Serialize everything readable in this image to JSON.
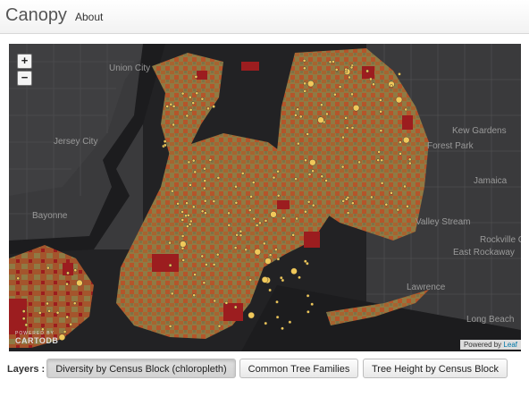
{
  "navbar": {
    "brand": "Canopy",
    "about": "About"
  },
  "map": {
    "place_labels": [
      "Union City",
      "Jersey City",
      "Bayonne",
      "Kew Gardens",
      "Forest Park",
      "Jamaica",
      "Valley Stream",
      "Rockville Cen",
      "East Rockaway",
      "Lawrence",
      "Long Beach"
    ],
    "powered_by_label": "POWERED BY",
    "carto_logo": "CARTODB",
    "attribution_prefix": "Powered by",
    "attribution_link": "Leaf",
    "zoom_in": "+",
    "zoom_out": "−",
    "colors": {
      "water": "#222224",
      "land": "#38383a",
      "choropleth_low": "#8f7a44",
      "choropleth_mid": "#b5552a",
      "choropleth_high": "#9c1d1f",
      "tree_point": "#f0c85a"
    }
  },
  "layers": {
    "label": "Layers :",
    "buttons": [
      {
        "label": "Diversity by Census Block (chloropleth)",
        "active": true
      },
      {
        "label": "Common Tree Families",
        "active": false
      },
      {
        "label": "Tree Height by Census Block",
        "active": false
      }
    ]
  }
}
